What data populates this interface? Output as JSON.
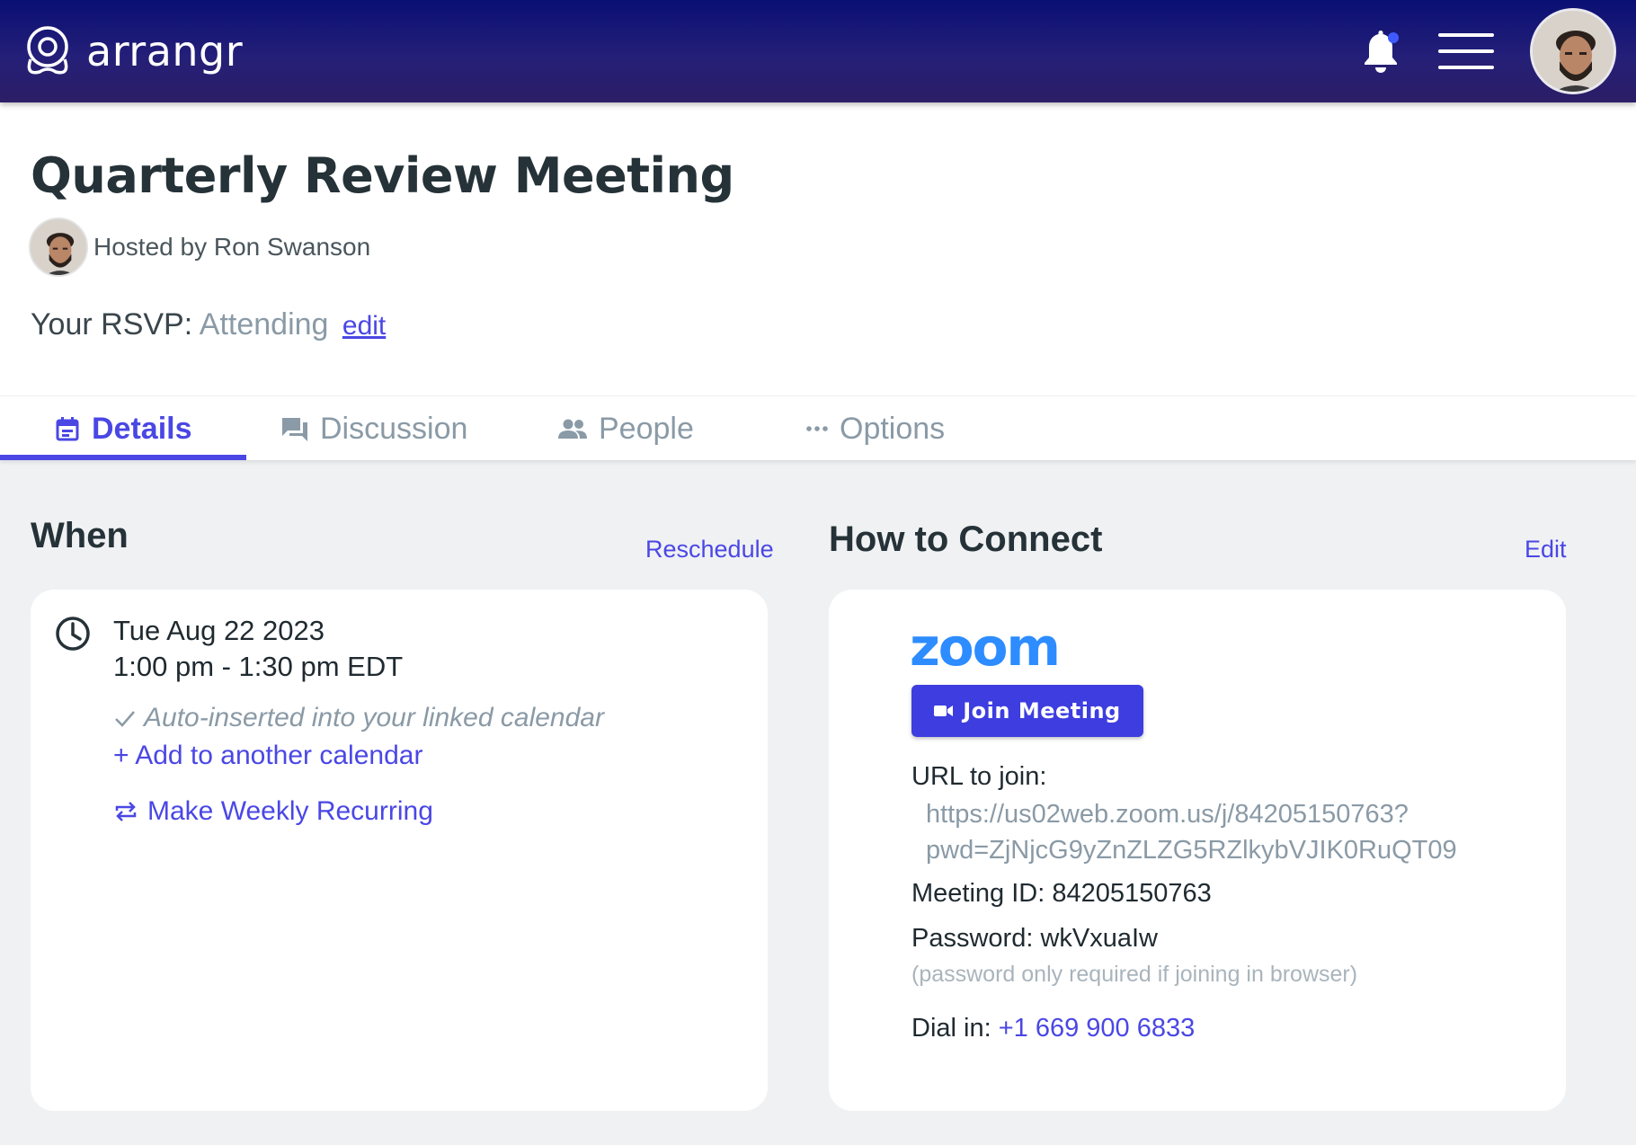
{
  "app": {
    "brand_name": "arrangr",
    "accent_color": "#4a47e5",
    "header_gradient": [
      "#0a0f74",
      "#2c1e66"
    ]
  },
  "header": {
    "icons": [
      "arrangr-logo-icon",
      "bell-icon",
      "hamburger-menu-icon",
      "user-avatar"
    ]
  },
  "event": {
    "title": "Quarterly Review Meeting",
    "host_text": "Hosted by Ron Swanson",
    "rsvp_label": "Your RSVP:",
    "rsvp_value": "Attending",
    "rsvp_edit": "edit"
  },
  "tabs": [
    {
      "label": "Details",
      "icon": "calendar-icon",
      "active": true
    },
    {
      "label": "Discussion",
      "icon": "chat-icon",
      "active": false
    },
    {
      "label": "People",
      "icon": "people-icon",
      "active": false
    },
    {
      "label": "Options",
      "icon": "more-horizontal-icon",
      "active": false
    }
  ],
  "when": {
    "heading": "When",
    "reschedule": "Reschedule",
    "date": "Tue Aug 22 2023",
    "time": "1:00 pm - 1:30 pm EDT",
    "auto_inserted": "Auto-inserted into your linked calendar",
    "add_calendar": "+ Add to another calendar",
    "recurring": "Make Weekly Recurring"
  },
  "connect": {
    "heading": "How to Connect",
    "edit": "Edit",
    "provider_logo": "zoom",
    "join_label": "Join Meeting",
    "url_label": "URL to join:",
    "url_line1": "https://us02web.zoom.us/j/84205150763?",
    "url_line2": "pwd=ZjNjcG9yZnZLZG5RZlkybVJIK0RuQT09",
    "meeting_id": "Meeting ID: 84205150763",
    "password": "Password: wkVxuaIw",
    "password_note": "(password only required if joining in browser)",
    "dial_label": "Dial in:",
    "dial_number": "+1 669 900 6833"
  }
}
